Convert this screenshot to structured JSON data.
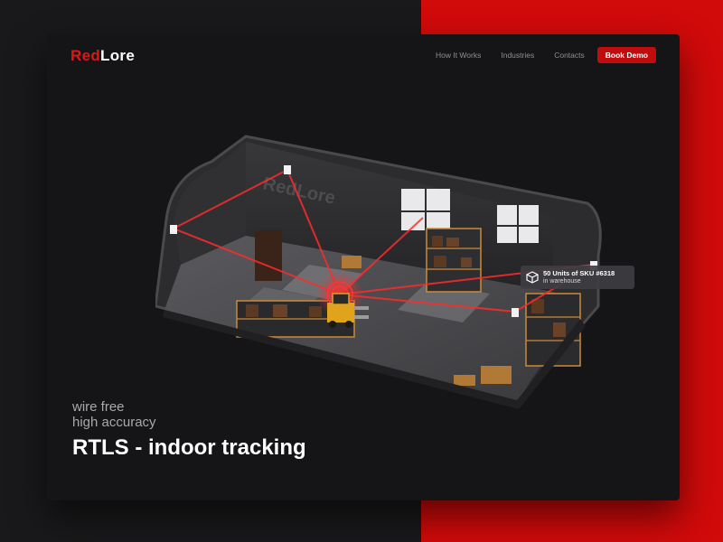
{
  "brand": {
    "logo_red": "Red",
    "logo_white": "Lore",
    "accent": "#e51414"
  },
  "nav": {
    "links": [
      "How It Works",
      "Industries",
      "Contacts"
    ],
    "cta": "Book Demo"
  },
  "tooltip": {
    "icon": "package-icon",
    "title": "50 Units of SKU #6318",
    "subtitle": "in warehouse"
  },
  "hero": {
    "line1": "wire free",
    "line2": "high accuracy",
    "title": "RTLS - indoor tracking"
  },
  "colors": {
    "page_left": "#19191b",
    "page_right": "#d10a0a",
    "card": "#151517",
    "button": "#c00c0c"
  }
}
